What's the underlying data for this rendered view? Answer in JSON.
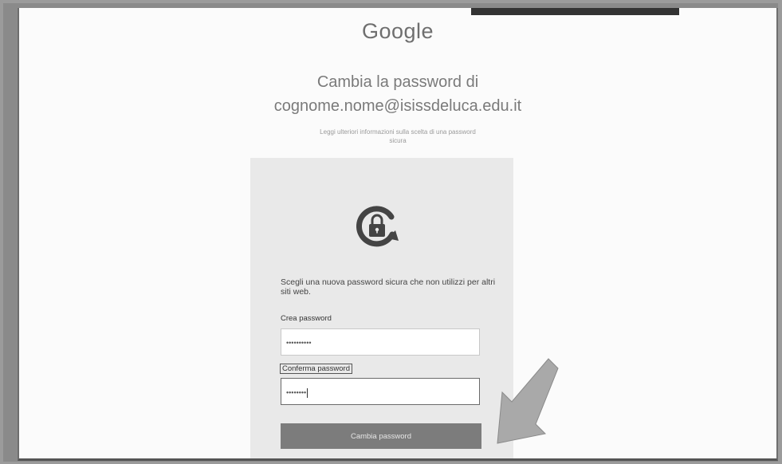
{
  "logo": "Google",
  "title": {
    "line1": "Cambia la password di",
    "line2": "cognome.nome@isissdeluca.edu.it"
  },
  "subtitle": {
    "line1": "Leggi ulteriori informazioni sulla scelta di una password",
    "line2": "sicura"
  },
  "card": {
    "icon": "lock-refresh-icon",
    "instructions": "Scegli una nuova password sicura che non utilizzi per altri siti web.",
    "new_password": {
      "label": "Crea password",
      "value": "••••••••••"
    },
    "confirm_password": {
      "label": "Conferma password",
      "value": "••••••••"
    },
    "submit_label": "Cambia password"
  },
  "annotation": {
    "icon": "pointer-arrow-icon"
  },
  "colors": {
    "button": "#7c7c7c",
    "card": "#e9e9e9",
    "page": "#fbfbfb"
  }
}
